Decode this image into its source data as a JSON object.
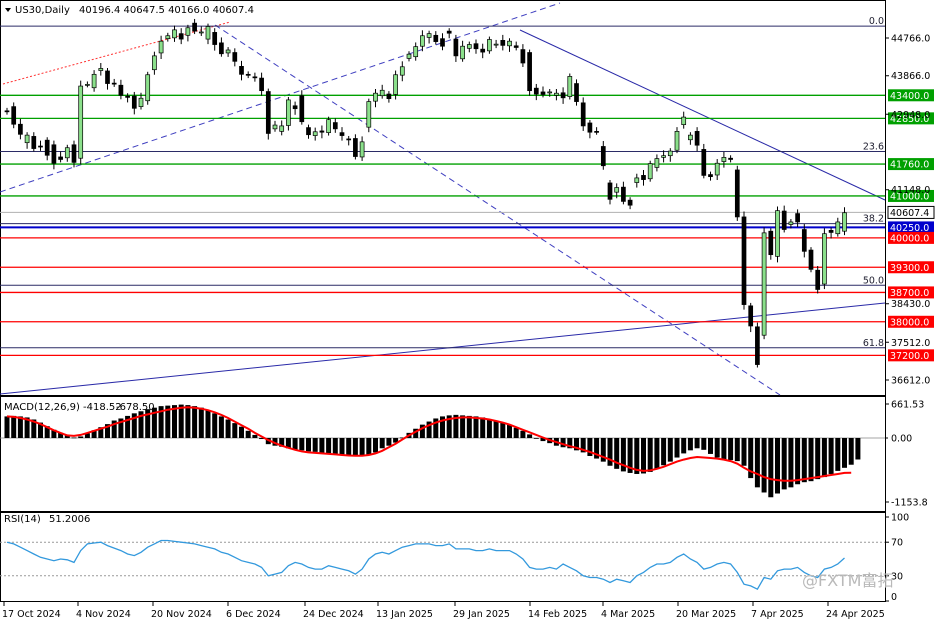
{
  "header": {
    "symbol": "US30,Daily",
    "ohlc": "40196.4 40647.5 40166.0 40607.4"
  },
  "watermark": "@FXTM富拓",
  "colors": {
    "bull": "#8be08b",
    "bear": "#000000",
    "support": "#ff0000",
    "resistance": "#00a000",
    "pivot": "#0000cc",
    "trend": "#3333aa",
    "macd_signal": "#ff0000",
    "rsi_line": "#3399dd"
  },
  "chart_data": {
    "type": "candlestick",
    "symbol": "US30",
    "timeframe": "Daily",
    "last_price": "40607.4",
    "price_axis_ticks": [
      "44766.0",
      "43866.0",
      "42948.0",
      "41148.0",
      "38430.0",
      "37512.0",
      "36612.0"
    ],
    "date_labels": [
      "17 Oct 2024",
      "4 Nov 2024",
      "20 Nov 2024",
      "6 Dec 2024",
      "24 Dec 2024",
      "13 Jan 2025",
      "29 Jan 2025",
      "14 Feb 2025",
      "4 Mar 2025",
      "20 Mar 2025",
      "7 Apr 2025",
      "24 Apr 2025"
    ],
    "levels": [
      {
        "price": 43400,
        "label": "43400.0",
        "kind": "resistance"
      },
      {
        "price": 42850,
        "label": "42850.0",
        "kind": "resistance"
      },
      {
        "price": 41760,
        "label": "41760.0",
        "kind": "resistance"
      },
      {
        "price": 41000,
        "label": "41000.0",
        "kind": "resistance"
      },
      {
        "price": 40250,
        "label": "40250.0",
        "kind": "pivot"
      },
      {
        "price": 40000,
        "label": "40000.0",
        "kind": "support"
      },
      {
        "price": 39300,
        "label": "39300.0",
        "kind": "support"
      },
      {
        "price": 38700,
        "label": "38700.0",
        "kind": "support"
      },
      {
        "price": 38000,
        "label": "38000.0",
        "kind": "support"
      },
      {
        "price": 37200,
        "label": "37200.0",
        "kind": "support"
      }
    ],
    "fib_levels": [
      {
        "label": "0.0",
        "price": 45050
      },
      {
        "label": "23.6",
        "price": 42060
      },
      {
        "label": "38.2",
        "price": 40340
      },
      {
        "label": "50.0",
        "price": 38870
      },
      {
        "label": "61.8",
        "price": 37380
      }
    ],
    "candles": [
      [
        43030,
        43010
      ],
      [
        43130,
        42710
      ],
      [
        42710,
        42470
      ],
      [
        42270,
        42450
      ],
      [
        42420,
        42130
      ],
      [
        42190,
        42170
      ],
      [
        42330,
        41970
      ],
      [
        42220,
        41780
      ],
      [
        41930,
        41870
      ],
      [
        41910,
        42150
      ],
      [
        42220,
        41800
      ],
      [
        41900,
        43620
      ],
      [
        43660,
        43660
      ],
      [
        43580,
        43900
      ],
      [
        43990,
        44040
      ],
      [
        43980,
        43680
      ],
      [
        43690,
        43670
      ],
      [
        43640,
        43400
      ],
      [
        43380,
        43350
      ],
      [
        43380,
        43090
      ],
      [
        43130,
        43330
      ],
      [
        43270,
        43890
      ],
      [
        44010,
        44340
      ],
      [
        44410,
        44690
      ],
      [
        44750,
        44820
      ],
      [
        44770,
        44960
      ],
      [
        44870,
        44740
      ],
      [
        44830,
        45010
      ],
      [
        45120,
        44930
      ],
      [
        44910,
        44910
      ],
      [
        44740,
        45040
      ],
      [
        44900,
        44610
      ],
      [
        44650,
        44390
      ],
      [
        44410,
        44480
      ],
      [
        44420,
        44210
      ],
      [
        44090,
        43900
      ],
      [
        43900,
        43880
      ],
      [
        43840,
        43820
      ],
      [
        43810,
        43510
      ],
      [
        43490,
        42490
      ],
      [
        42600,
        42690
      ],
      [
        42540,
        42670
      ],
      [
        42680,
        43290
      ],
      [
        43150,
        43080
      ],
      [
        43390,
        42770
      ],
      [
        42630,
        42460
      ],
      [
        42440,
        42530
      ],
      [
        42550,
        42520
      ],
      [
        42510,
        42820
      ],
      [
        42750,
        42600
      ],
      [
        42510,
        42440
      ],
      [
        42360,
        42350
      ],
      [
        42370,
        41940
      ],
      [
        41930,
        42290
      ],
      [
        42640,
        43250
      ],
      [
        43260,
        43450
      ],
      [
        43390,
        43520
      ],
      [
        43430,
        43320
      ],
      [
        43420,
        43890
      ],
      [
        43880,
        44080
      ],
      [
        44280,
        44380
      ],
      [
        44320,
        44560
      ],
      [
        44570,
        44820
      ],
      [
        44780,
        44870
      ],
      [
        44830,
        44680
      ],
      [
        44750,
        44570
      ],
      [
        44930,
        44880
      ],
      [
        44740,
        44340
      ],
      [
        44270,
        44570
      ],
      [
        44520,
        44610
      ],
      [
        44630,
        44510
      ],
      [
        44500,
        44430
      ],
      [
        44460,
        44730
      ],
      [
        44620,
        44620
      ],
      [
        44710,
        44590
      ],
      [
        44580,
        44690
      ],
      [
        44580,
        44540
      ],
      [
        44490,
        44170
      ],
      [
        44420,
        43510
      ],
      [
        43570,
        43430
      ],
      [
        43480,
        43420
      ],
      [
        43460,
        43480
      ],
      [
        43400,
        43450
      ],
      [
        43460,
        43340
      ],
      [
        43370,
        43850
      ],
      [
        43680,
        43250
      ],
      [
        43220,
        42670
      ],
      [
        42740,
        42520
      ],
      [
        42540,
        42530
      ],
      [
        42180,
        41720
      ],
      [
        41310,
        40920
      ],
      [
        41090,
        41200
      ],
      [
        41210,
        40870
      ],
      [
        40900,
        40780
      ],
      [
        41320,
        41430
      ],
      [
        41490,
        41390
      ],
      [
        41410,
        41770
      ],
      [
        41680,
        41890
      ],
      [
        41920,
        41960
      ],
      [
        41960,
        42070
      ],
      [
        42090,
        42540
      ],
      [
        42700,
        42880
      ],
      [
        42340,
        42450
      ],
      [
        42540,
        42210
      ],
      [
        42110,
        41490
      ],
      [
        41510,
        41460
      ],
      [
        41500,
        41780
      ],
      [
        41820,
        41920
      ],
      [
        41900,
        41870
      ],
      [
        41620,
        40500
      ],
      [
        40500,
        38410
      ],
      [
        38380,
        37900
      ],
      [
        37880,
        36980
      ],
      [
        37680,
        40120
      ],
      [
        40160,
        39600
      ],
      [
        39560,
        40650
      ],
      [
        40640,
        40200
      ],
      [
        40320,
        40380
      ],
      [
        40580,
        40380
      ],
      [
        40200,
        39680
      ],
      [
        39710,
        39250
      ],
      [
        39230,
        38770
      ],
      [
        38900,
        40100
      ],
      [
        40180,
        40130
      ],
      [
        40100,
        40380
      ],
      [
        40160,
        40600
      ]
    ],
    "macd": {
      "label": "MACD(12,26,9)",
      "histogram_value": "-418.52",
      "signal_value": "-678.50",
      "axis_ticks": [
        "661.53",
        "0.00",
        "-1153.8"
      ],
      "histogram": [
        420,
        430,
        420,
        400,
        360,
        300,
        230,
        160,
        100,
        50,
        10,
        30,
        90,
        150,
        210,
        270,
        340,
        380,
        430,
        480,
        520,
        560,
        590,
        620,
        630,
        640,
        650,
        640,
        620,
        590,
        540,
        480,
        420,
        360,
        290,
        220,
        140,
        60,
        -20,
        -120,
        -150,
        -170,
        -200,
        -230,
        -240,
        -260,
        -270,
        -290,
        -300,
        -310,
        -320,
        -330,
        -340,
        -350,
        -330,
        -280,
        -200,
        -150,
        -90,
        10,
        100,
        180,
        260,
        320,
        380,
        420,
        440,
        450,
        440,
        430,
        420,
        400,
        370,
        340,
        300,
        260,
        200,
        140,
        70,
        -10,
        -60,
        -100,
        -150,
        -180,
        -200,
        -240,
        -280,
        -350,
        -400,
        -460,
        -540,
        -600,
        -650,
        -680,
        -700,
        -690,
        -660,
        -600,
        -530,
        -460,
        -380,
        -300,
        -240,
        -200,
        -230,
        -310,
        -380,
        -420,
        -430,
        -450,
        -540,
        -780,
        -960,
        -1060,
        -1153,
        -1080,
        -1000,
        -960,
        -900,
        -860,
        -840,
        -800,
        -760,
        -700,
        -640,
        -580,
        -520,
        -418
      ],
      "signal": [
        420,
        410,
        390,
        360,
        320,
        270,
        210,
        150,
        100,
        50,
        40,
        60,
        100,
        140,
        180,
        220,
        270,
        310,
        350,
        390,
        430,
        460,
        490,
        520,
        550,
        570,
        590,
        600,
        590,
        570,
        540,
        500,
        450,
        390,
        320,
        250,
        180,
        100,
        30,
        -40,
        -100,
        -150,
        -190,
        -230,
        -260,
        -280,
        -290,
        -300,
        -310,
        -320,
        -330,
        -340,
        -345,
        -345,
        -330,
        -300,
        -250,
        -180,
        -110,
        -30,
        50,
        120,
        190,
        250,
        300,
        340,
        370,
        390,
        400,
        400,
        390,
        380,
        360,
        330,
        300,
        260,
        210,
        160,
        110,
        60,
        10,
        -40,
        -80,
        -120,
        -160,
        -190,
        -230,
        -270,
        -320,
        -370,
        -420,
        -480,
        -530,
        -580,
        -620,
        -640,
        -630,
        -600,
        -560,
        -510,
        -460,
        -420,
        -390,
        -370,
        -380,
        -390,
        -400,
        -420,
        -450,
        -500,
        -580,
        -650,
        -700,
        -760,
        -800,
        -820,
        -830,
        -830,
        -820,
        -800,
        -780,
        -760,
        -740,
        -720,
        -700,
        -680,
        -678
      ]
    },
    "rsi": {
      "label": "RSI(14)",
      "value": "51.2006",
      "axis_ticks": [
        "100",
        "70",
        "30",
        "0"
      ],
      "levels": [
        70,
        30
      ],
      "values": [
        70,
        68,
        64,
        60,
        56,
        52,
        50,
        48,
        50,
        49,
        46,
        60,
        68,
        69,
        70,
        66,
        63,
        60,
        56,
        54,
        58,
        64,
        68,
        72,
        72,
        71,
        70,
        69,
        68,
        66,
        64,
        62,
        58,
        56,
        52,
        48,
        46,
        44,
        40,
        30,
        32,
        34,
        42,
        46,
        44,
        40,
        38,
        38,
        42,
        40,
        38,
        36,
        32,
        38,
        50,
        56,
        58,
        56,
        60,
        64,
        66,
        68,
        68,
        68,
        66,
        66,
        68,
        62,
        62,
        62,
        60,
        60,
        62,
        60,
        60,
        60,
        56,
        50,
        40,
        38,
        38,
        40,
        38,
        44,
        40,
        36,
        30,
        28,
        28,
        26,
        22,
        26,
        24,
        22,
        30,
        34,
        40,
        44,
        44,
        46,
        52,
        56,
        50,
        46,
        38,
        40,
        44,
        46,
        44,
        34,
        20,
        18,
        14,
        28,
        26,
        36,
        38,
        38,
        40,
        34,
        30,
        28,
        38,
        40,
        44,
        51.2
      ]
    }
  }
}
